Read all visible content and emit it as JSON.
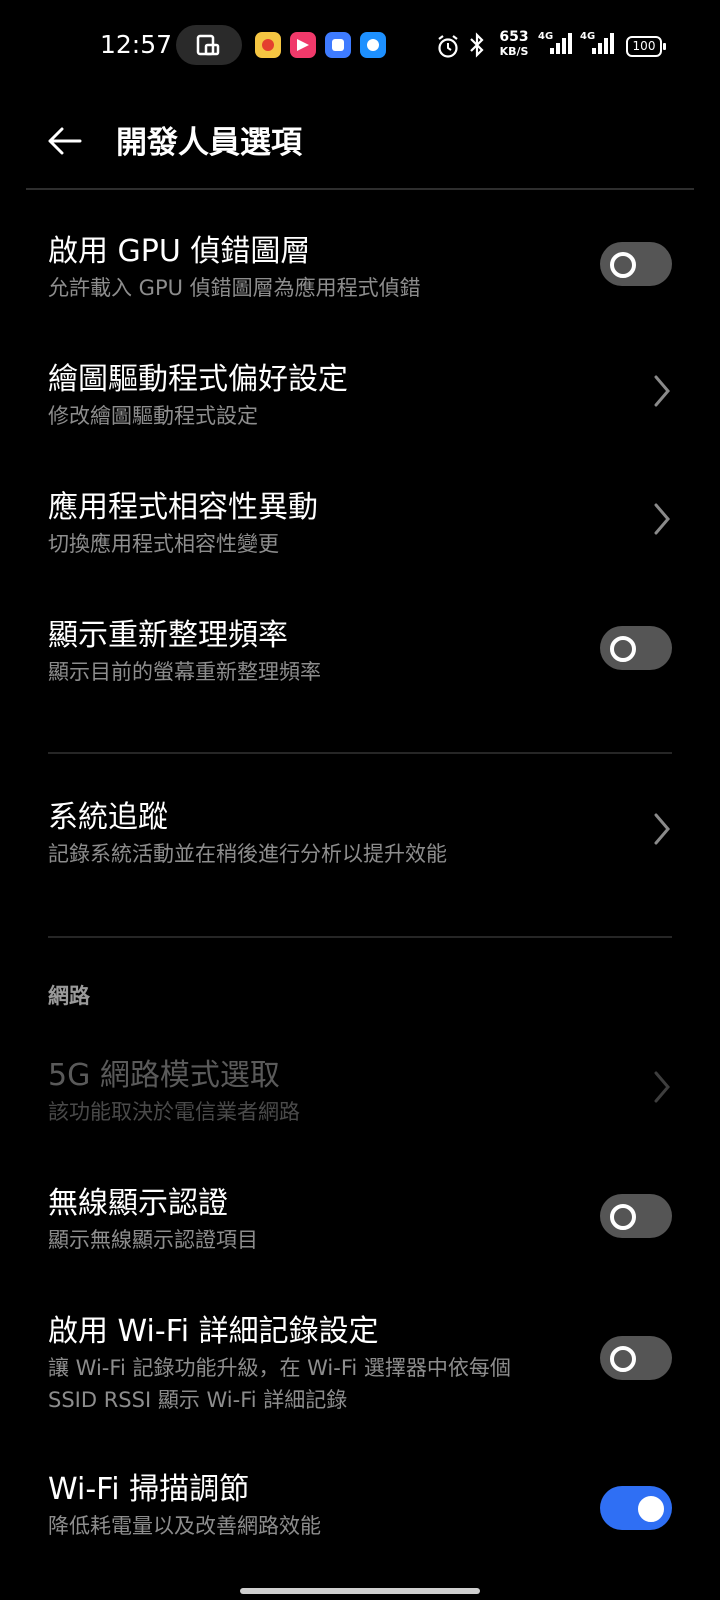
{
  "status_bar": {
    "time": "12:57",
    "speed_value": "653",
    "speed_unit": "KB/S",
    "signal1_label": "4G",
    "signal2_label": "4G",
    "battery": "100"
  },
  "header": {
    "title": "開發人員選項"
  },
  "settings": [
    {
      "title": "啟用 GPU 偵錯圖層",
      "subtitle": "允許載入 GPU 偵錯圖層為應用程式偵錯",
      "control": "toggle",
      "on": false
    },
    {
      "title": "繪圖驅動程式偏好設定",
      "subtitle": "修改繪圖驅動程式設定",
      "control": "chevron"
    },
    {
      "title": "應用程式相容性異動",
      "subtitle": "切換應用程式相容性變更",
      "control": "chevron"
    },
    {
      "title": "顯示重新整理頻率",
      "subtitle": "顯示目前的螢幕重新整理頻率",
      "control": "toggle",
      "on": false
    },
    {
      "title": "系統追蹤",
      "subtitle": "記錄系統活動並在稍後進行分析以提升效能",
      "control": "chevron"
    },
    {
      "title": "5G 網路模式選取",
      "subtitle": "該功能取決於電信業者網路",
      "control": "chevron",
      "disabled": true
    },
    {
      "title": "無線顯示認證",
      "subtitle": "顯示無線顯示認證項目",
      "control": "toggle",
      "on": false
    },
    {
      "title": "啟用 Wi-Fi 詳細記錄設定",
      "subtitle_line1": "讓 Wi-Fi 記錄功能升級，在 Wi-Fi 選擇器中依每個",
      "subtitle_line2": "SSID RSSI 顯示 Wi-Fi 詳細記錄",
      "control": "toggle",
      "on": false
    },
    {
      "title": "Wi-Fi 掃描調節",
      "subtitle": "降低耗電量以及改善網路效能",
      "control": "toggle",
      "on": true
    }
  ],
  "sections": {
    "network": "網路"
  },
  "colors": {
    "background": "#000000",
    "toggle_on": "#2f6ff4",
    "toggle_off": "#555555",
    "subtitle": "#8d8d8d"
  }
}
